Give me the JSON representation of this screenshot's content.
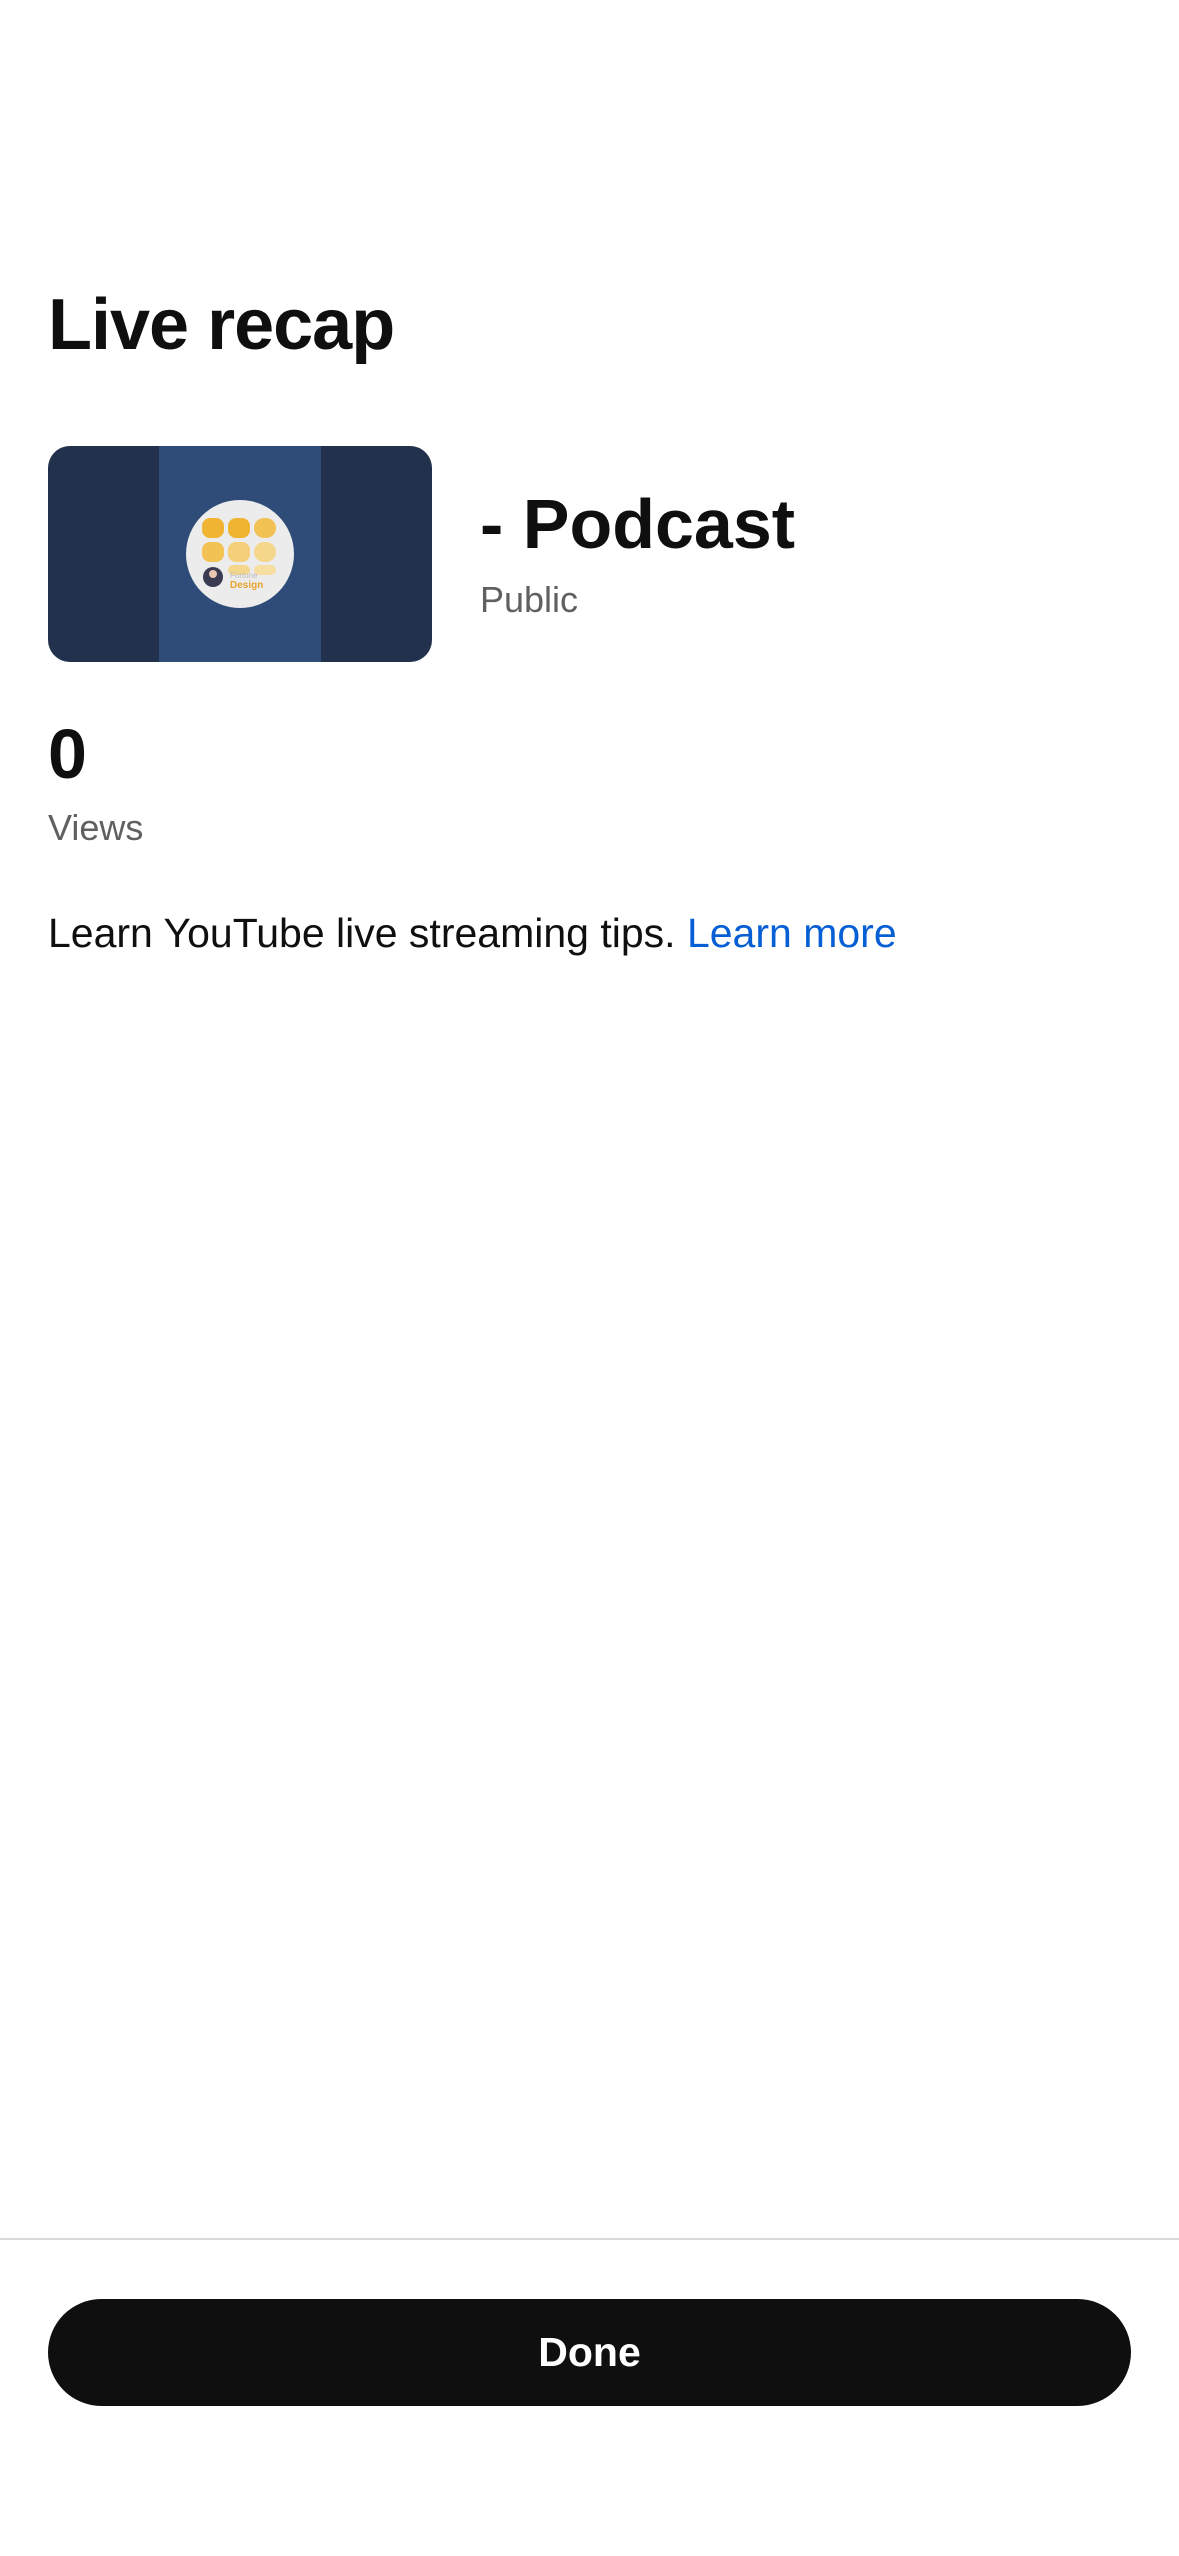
{
  "page": {
    "title": "Live recap"
  },
  "video": {
    "title": "- Podcast",
    "visibility": "Public",
    "thumbnail_icon": "podcast-logo-icon"
  },
  "stats": {
    "views_count": "0",
    "views_label": "Views"
  },
  "tips": {
    "text": "Learn YouTube live streaming tips.",
    "link_label": "Learn more"
  },
  "footer": {
    "done_label": "Done"
  },
  "colors": {
    "link": "#065fd4",
    "button_bg": "#0f0f0f",
    "secondary_text": "#606060",
    "thumbnail_bg": "#22324d",
    "thumbnail_center": "#2f4c78"
  }
}
